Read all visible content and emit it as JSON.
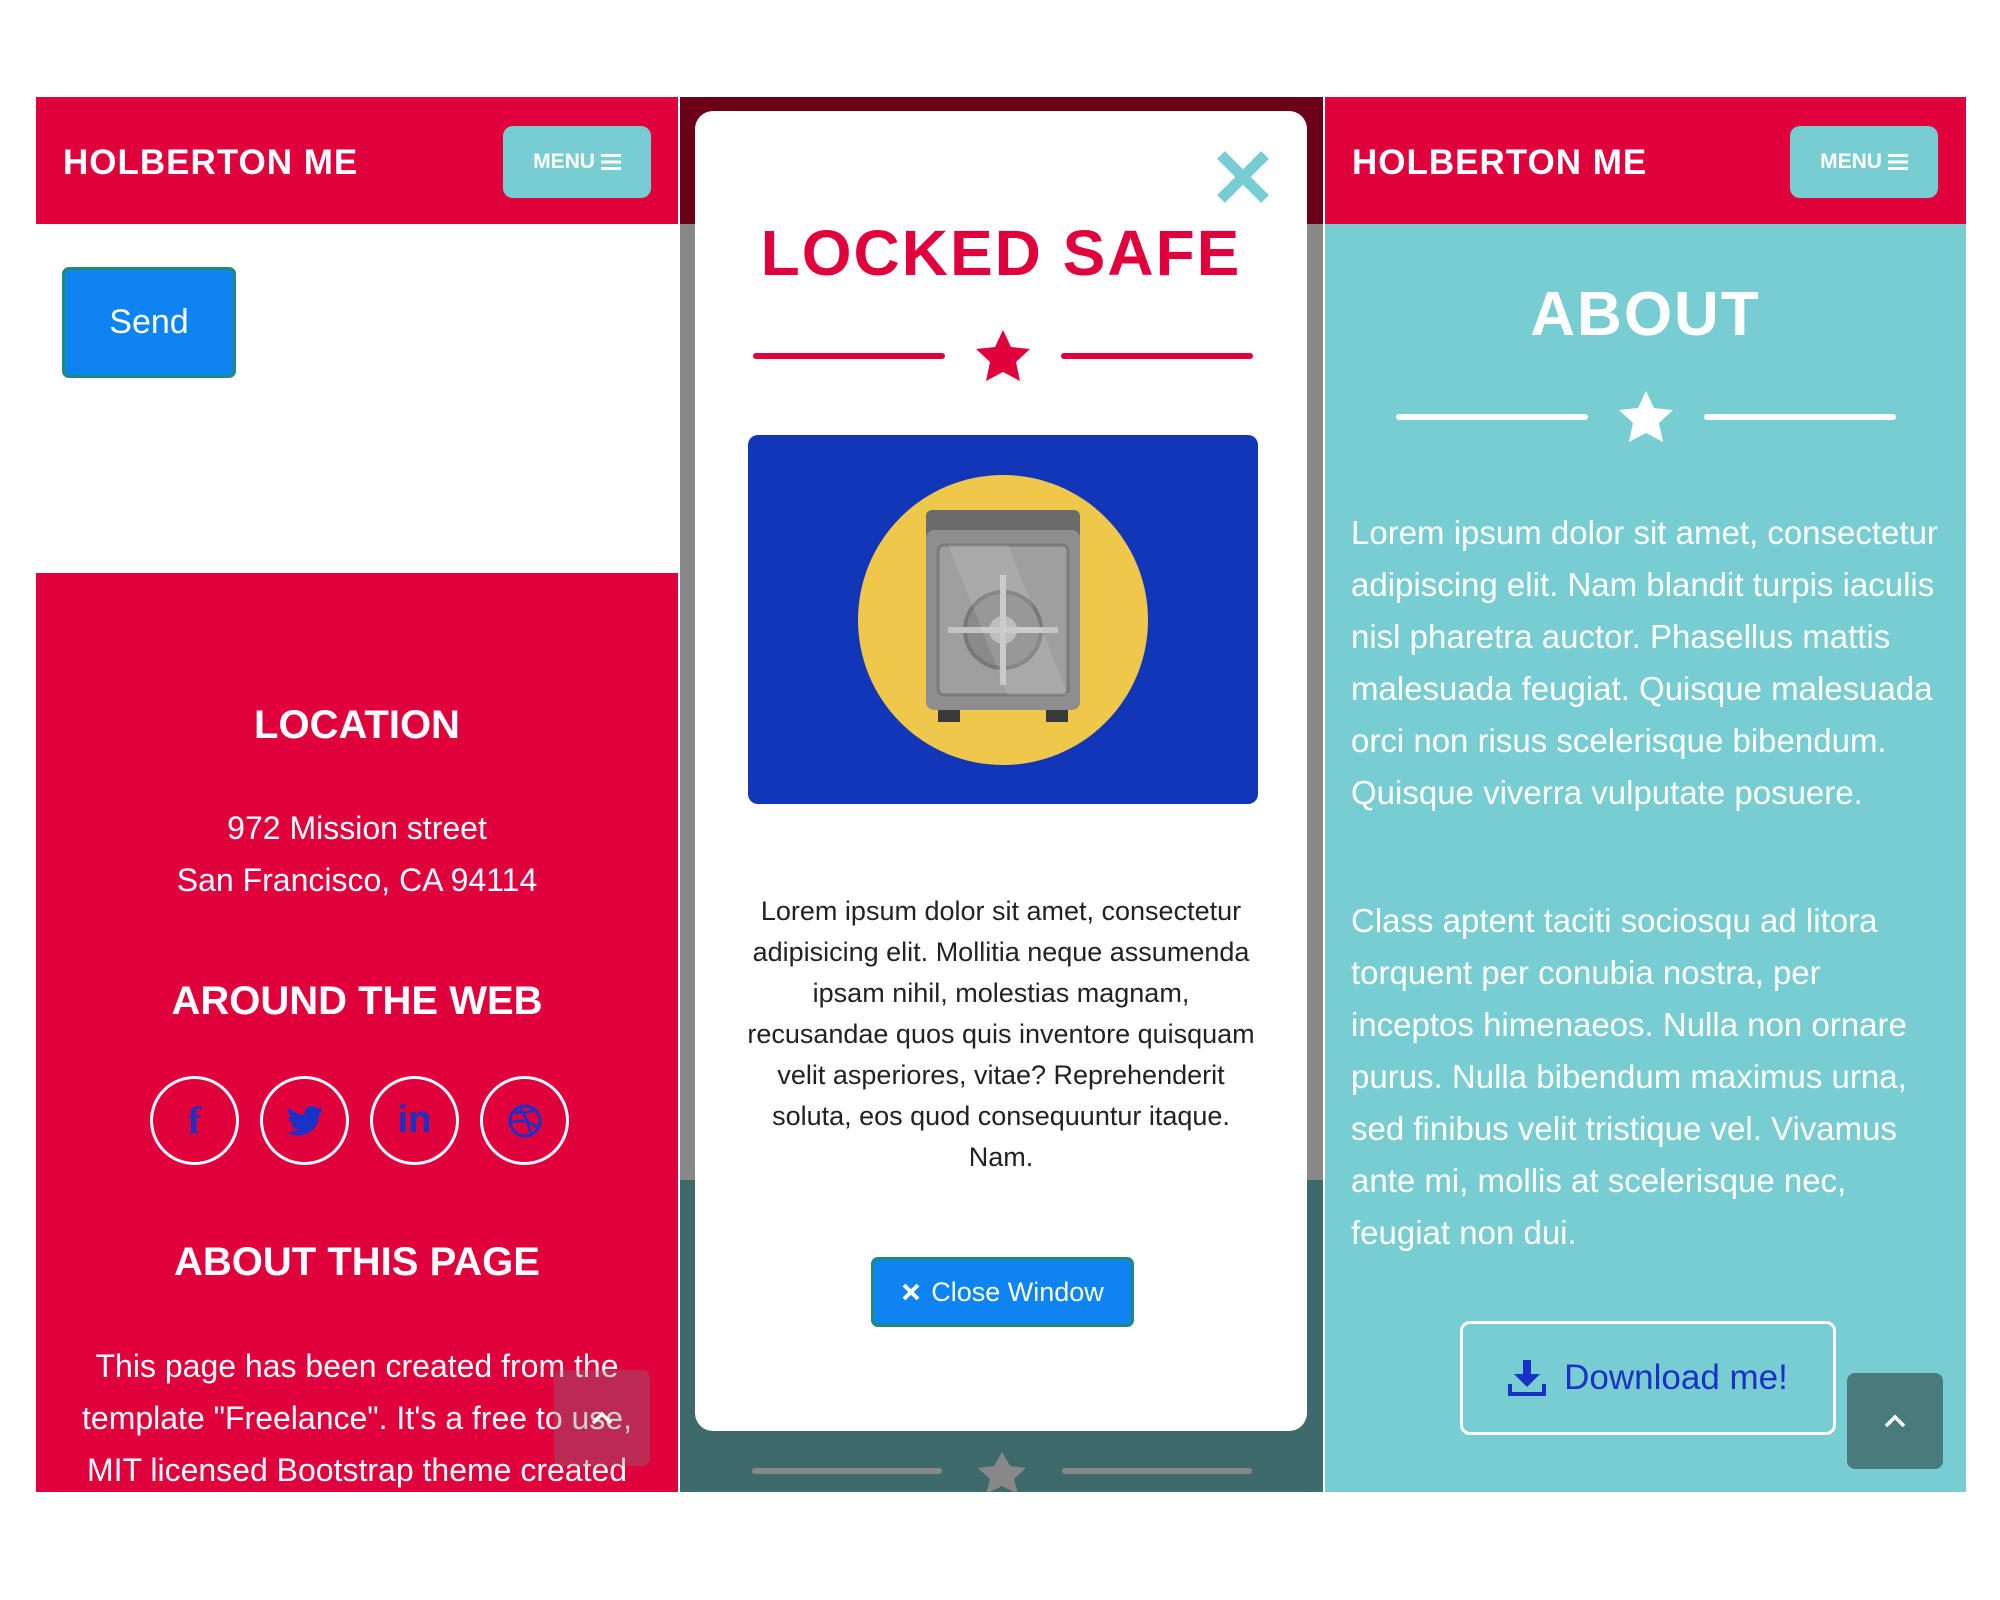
{
  "panel1": {
    "brand": "HOLBERTON ME",
    "menu_label": "MENU",
    "send_label": "Send",
    "location_heading": "LOCATION",
    "address_line1": "972 Mission street",
    "address_line2": "San Francisco, CA 94114",
    "around_heading": "AROUND THE WEB",
    "social": [
      {
        "icon": "facebook-icon",
        "glyph": "f"
      },
      {
        "icon": "twitter-icon",
        "glyph": ""
      },
      {
        "icon": "linkedin-icon",
        "glyph": "in"
      },
      {
        "icon": "dribbble-icon",
        "glyph": ""
      }
    ],
    "about_heading": "ABOUT THIS PAGE",
    "about_text": "This page has been created from the template \"Freelance\". It's a free to use, MIT licensed Bootstrap theme created"
  },
  "panel2": {
    "modal_title": "LOCKED SAFE",
    "modal_text": "Lorem ipsum dolor sit amet, consectetur adipisicing elit. Mollitia neque assumenda ipsam nihil, molestias magnam, recusandae quos quis inventore quisquam velit asperiores, vitae? Reprehenderit soluta, eos quod consequuntur itaque. Nam.",
    "close_button_label": "Close Window"
  },
  "panel3": {
    "brand": "HOLBERTON ME",
    "menu_label": "MENU",
    "about_title": "ABOUT",
    "paragraph1": "Lorem ipsum dolor sit amet, consectetur adipiscing elit. Nam blandit turpis iaculis nisl pharetra auctor. Phasellus mattis malesuada feugiat. Quisque malesuada orci non risus scelerisque bibendum. Quisque viverra vulputate posuere.",
    "paragraph2": "Class aptent taciti sociosqu ad litora torquent per conubia nostra, per inceptos himenaeos. Nulla non ornare purus. Nulla bibendum maximus urna, sed finibus velit tristique vel. Vivamus ante mi, mollis at scelerisque nec, feugiat non dui.",
    "download_label": "Download me!"
  },
  "colors": {
    "primary_red": "#e0003c",
    "teal": "#78cdd2",
    "button_blue": "#0d84f2",
    "safe_background": "#1236b8",
    "icon_blue": "#1a31c8"
  }
}
